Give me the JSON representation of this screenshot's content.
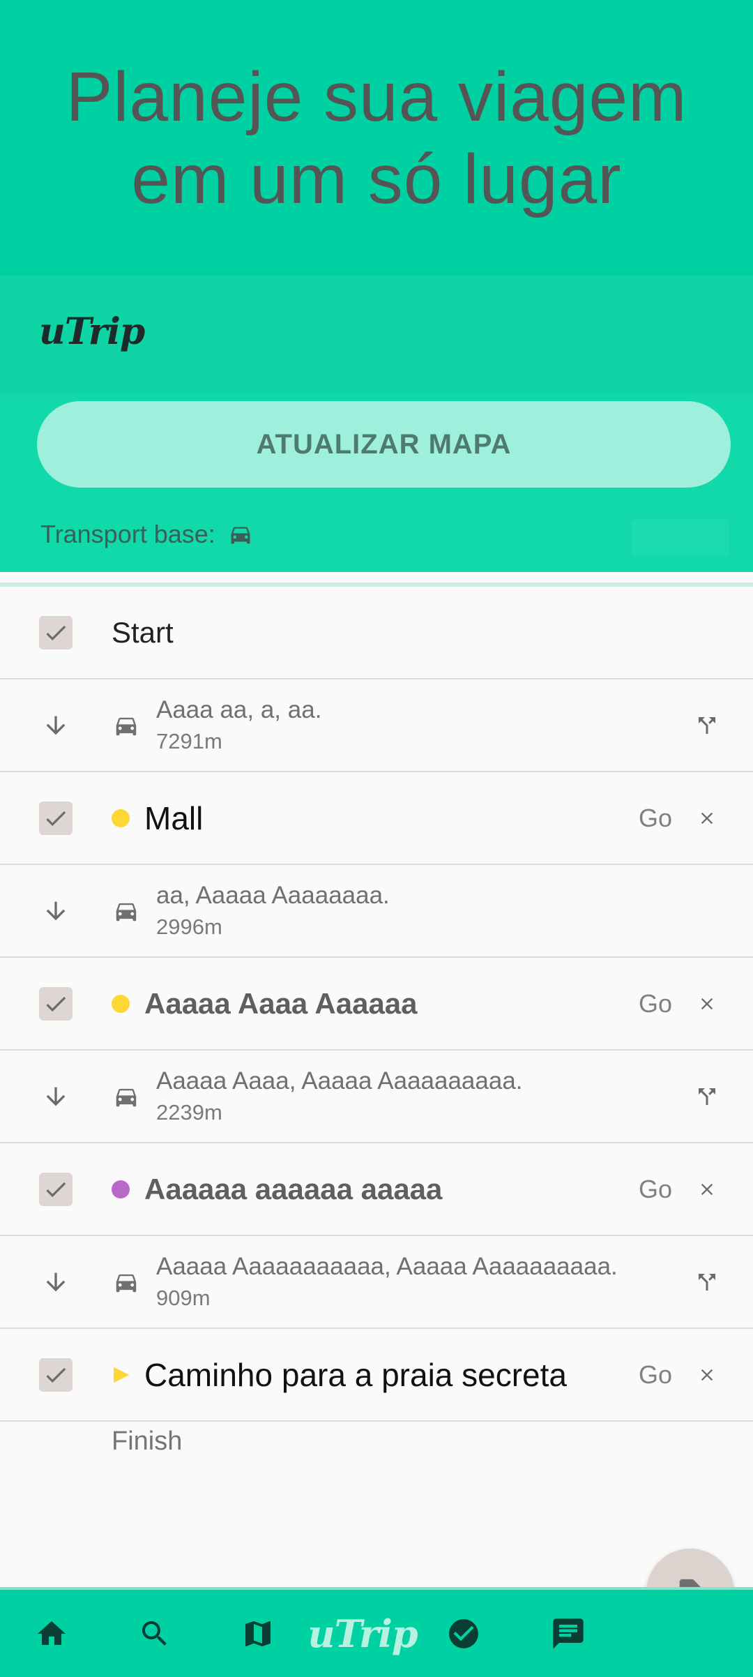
{
  "hero": {
    "title_line1": "Planeje sua viagem",
    "title_line2": "em um só lugar"
  },
  "panel": {
    "logo": "uTrip",
    "update_button": "ATUALIZAR MAPA",
    "transport_label": "Transport base:",
    "transport_icon": "car-icon"
  },
  "list": {
    "start": {
      "label": "Start",
      "checked": true
    },
    "legs": [
      {
        "address": "Aaaa aa, a, aa.",
        "distance": "7291m",
        "has_fork": true
      },
      {
        "address": "aa, Aaaaa Aaaaaaaa.",
        "distance": "2996m",
        "has_fork": false
      },
      {
        "address": "Aaaaa Aaaa, Aaaaa Aaaaaaaaaa.",
        "distance": "2239m",
        "has_fork": true
      },
      {
        "address": "Aaaaa Aaaaaaaaaaa, Aaaaa Aaaaaaaaaa.",
        "distance": "909m",
        "has_fork": true
      }
    ],
    "stops": [
      {
        "name": "Mall",
        "marker": "dot",
        "color": "#fdd835",
        "text_color": "#111111",
        "go": "Go",
        "checked": true
      },
      {
        "name": "Aaaaa Aaaa Aaaaaa",
        "marker": "dot",
        "color": "#fdd835",
        "text_color": "#5f5f5f",
        "go": "Go",
        "checked": true
      },
      {
        "name": "Aaaaaa aaaaaa aaaaa",
        "marker": "dot",
        "color": "#ba68c8",
        "text_color": "#5f5f5f",
        "go": "Go",
        "checked": true
      },
      {
        "name": "Caminho para a praia secreta",
        "marker": "triangle",
        "color": "#fdd835",
        "text_color": "#111111",
        "go": "Go",
        "checked": true
      }
    ],
    "finish": "Finish"
  },
  "fab": {
    "icon": "contact-page-icon"
  },
  "bottom_nav": {
    "items": [
      "home-icon",
      "search-icon",
      "map-icon",
      "uTrip",
      "check-circle-icon",
      "chat-icon"
    ],
    "logo": "uTrip"
  },
  "colors": {
    "primary": "#00d1a2",
    "button": "#9ef0dc",
    "background": "#fafafa"
  }
}
